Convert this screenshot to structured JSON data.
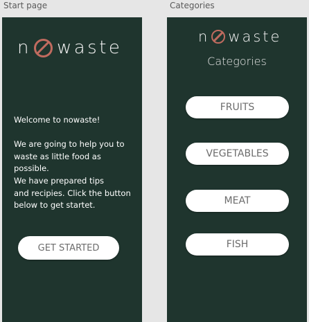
{
  "frames": {
    "start": {
      "label": "Start page"
    },
    "categories": {
      "label": "Categories"
    }
  },
  "logo": {
    "prefix": "n",
    "suffix": "waste"
  },
  "start_page": {
    "welcome_lines": [
      "Welcome to nowaste!",
      "",
      "We are going to help you to",
      "waste as little food as",
      "possible.",
      "We have prepared tips",
      "and recipies. Click the button",
      "below to get startet."
    ],
    "cta_label": "GET STARTED"
  },
  "categories_page": {
    "title": "Categories",
    "items": [
      "FRUITS",
      "VEGETABLES",
      "MEAT",
      "FISH"
    ]
  },
  "colors": {
    "screen_bg": "#1f352e",
    "accent": "#c06b5f",
    "button_bg": "#ffffff",
    "canvas_bg": "#e6e6e6"
  }
}
